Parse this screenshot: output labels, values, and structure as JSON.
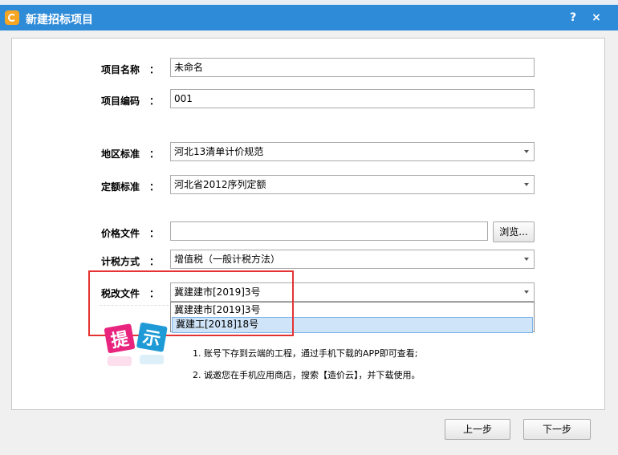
{
  "window": {
    "title": "新建招标项目",
    "help_label": "?",
    "close_label": "×"
  },
  "form": {
    "project_name": {
      "label": "项目名称",
      "colon": "：",
      "value": "未命名"
    },
    "project_code": {
      "label": "项目编码",
      "colon": "：",
      "value": "001"
    },
    "region_standard": {
      "label": "地区标准",
      "colon": "：",
      "value": "河北13清单计价规范"
    },
    "quota_standard": {
      "label": "定额标准",
      "colon": "：",
      "value": "河北省2012序列定额"
    },
    "price_file": {
      "label": "价格文件",
      "colon": "：",
      "value": "",
      "browse_label": "浏览..."
    },
    "tax_method": {
      "label": "计税方式",
      "colon": "：",
      "value": "增值税（一般计税方法）"
    },
    "tax_reform_file": {
      "label": "税改文件",
      "colon": "：",
      "value": "冀建建市[2019]3号",
      "options": [
        "冀建建市[2019]3号",
        "冀建工[2018]18号"
      ]
    }
  },
  "tips": {
    "logo_text": "提示",
    "lines": [
      "1. 账号下存到云端的工程，通过手机下载的APP即可查看;",
      "2. 诚邀您在手机应用商店，搜索【造价云】，并下载使用。"
    ]
  },
  "footer": {
    "prev_label": "上一步",
    "next_label": "下一步"
  },
  "colors": {
    "titlebar": "#2e8bd8",
    "highlight": "#e53333",
    "tip_pink": "#e8247e",
    "tip_blue": "#1e9ad6"
  }
}
